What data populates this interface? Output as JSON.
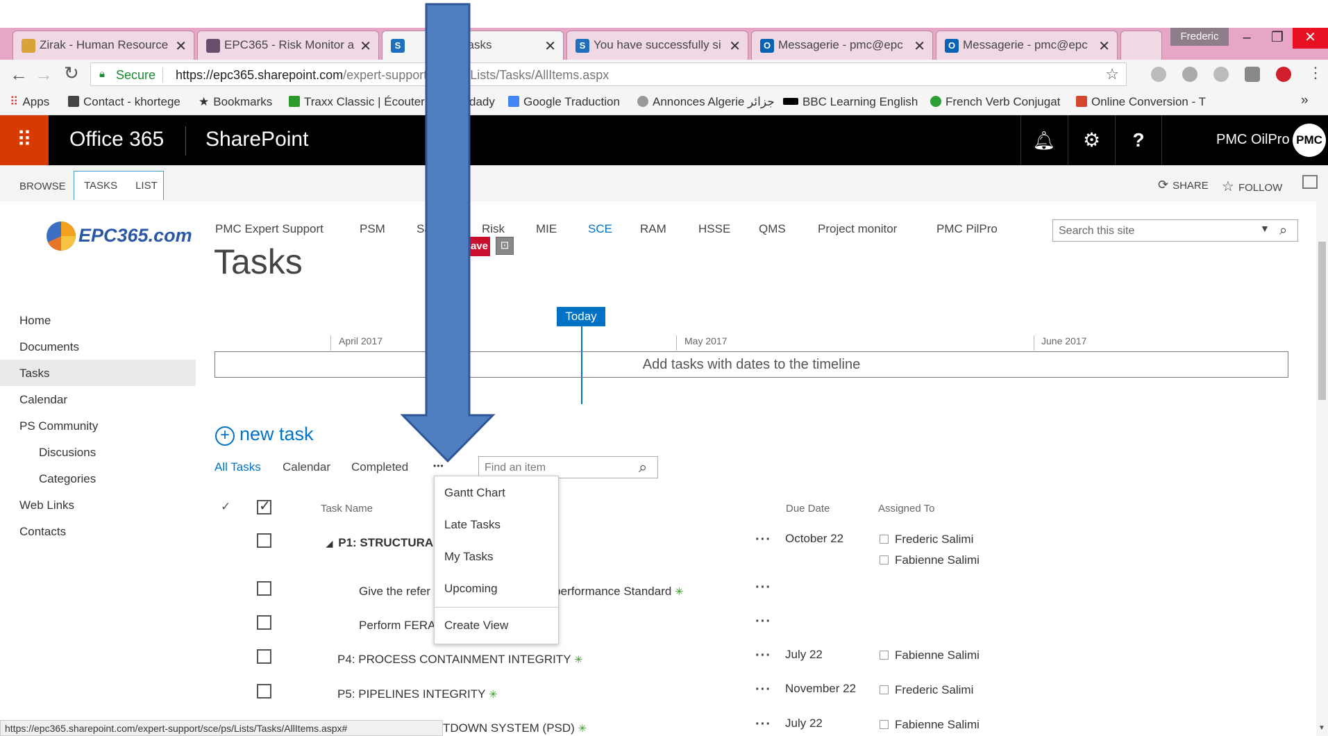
{
  "browser": {
    "tabs": [
      {
        "title": "Zirak - Human Resource",
        "icon_color": "#d9a33a"
      },
      {
        "title": "EPC365 - Risk Monitor a",
        "icon_color": "#6b4d6e"
      },
      {
        "title": "Tasks",
        "icon_color": "#1e6fbd"
      },
      {
        "title": "You have successfully si",
        "icon_color": "#1e6fbd"
      },
      {
        "title": "Messagerie - pmc@epc",
        "icon_color": "#0a62b5"
      },
      {
        "title": "Messagerie - pmc@epc",
        "icon_color": "#0a62b5"
      }
    ],
    "profile_name": "Frederic",
    "secure_label": "Secure",
    "url_host": "https://epc365.sharepoint.com",
    "url_path": "/expert-support/sce/ps/Lists/Tasks/AllItems.aspx",
    "bookmarks": [
      {
        "label": "Apps",
        "icon": "apps-grid-icon",
        "color": "#e53935"
      },
      {
        "label": "Contact - khortege",
        "icon": "bookmark-icon",
        "color": "#444"
      },
      {
        "label": "Bookmarks",
        "icon": "star-icon",
        "color": "#333"
      },
      {
        "label": "Traxx Classic | Écouter",
        "icon": "traxx-icon",
        "color": "#2a9a2a"
      },
      {
        "label": "dady",
        "icon": "page-icon",
        "color": "#888"
      },
      {
        "label": "Google Traduction",
        "icon": "google-translate-icon",
        "color": "#4285f4"
      },
      {
        "label": "Annonces Algerie جزائر",
        "icon": "annonces-icon",
        "color": "#999"
      },
      {
        "label": "BBC Learning English",
        "icon": "bbc-icon",
        "color": "#000"
      },
      {
        "label": "French Verb Conjugat",
        "icon": "conjugation-icon",
        "color": "#2e9e37"
      },
      {
        "label": "Online Conversion - T",
        "icon": "conversion-icon",
        "color": "#d4462d"
      }
    ],
    "more_bookmarks": "»",
    "status_url": "https://epc365.sharepoint.com/expert-support/sce/ps/Lists/Tasks/AllItems.aspx#"
  },
  "suite": {
    "office": "Office 365",
    "app": "SharePoint",
    "user": "PMC OilPro",
    "avatar": "PMC",
    "accent": "#d83b01"
  },
  "ribbon": {
    "tabs": [
      "BROWSE",
      "TASKS",
      "LIST"
    ],
    "share": "SHARE",
    "follow": "FOLLOW"
  },
  "site": {
    "logo_text": "EPC365.com",
    "topnav": [
      "PMC Expert Support",
      "PSM",
      "Sa",
      "Risk",
      "MIE",
      "SCE",
      "RAM",
      "HSSE",
      "QMS",
      "Project monitor",
      "PMC PilPro"
    ],
    "active_nav": "SCE",
    "search_placeholder": "Search this site",
    "page_title": "Tasks",
    "save_badge": "ave"
  },
  "quicklaunch": [
    {
      "label": "Home",
      "sub": false
    },
    {
      "label": "Documents",
      "sub": false
    },
    {
      "label": "Tasks",
      "sub": false
    },
    {
      "label": "Calendar",
      "sub": false
    },
    {
      "label": "PS Community",
      "sub": false
    },
    {
      "label": "Discusions",
      "sub": true
    },
    {
      "label": "Categories",
      "sub": true
    },
    {
      "label": "Web Links",
      "sub": false
    },
    {
      "label": "Contacts",
      "sub": false
    }
  ],
  "timeline": {
    "today": "Today",
    "months": [
      "April 2017",
      "May 2017",
      "June 2017"
    ],
    "placeholder": "Add tasks with dates to the timeline"
  },
  "list": {
    "new_task": "new task",
    "views": [
      "All Tasks",
      "Calendar",
      "Completed"
    ],
    "more": "•••",
    "find_placeholder": "Find an item",
    "columns": {
      "task": "Task Name",
      "due": "Due Date",
      "assigned": "Assigned To"
    },
    "rows": [
      {
        "name": "P1: STRUCTURA",
        "due": "October 22",
        "assigned": [
          "Frederic Salimi",
          "Fabienne Salimi"
        ],
        "bold": true,
        "indent": 1
      },
      {
        "name": "Give the refer",
        "name_tail": "s in performance Standard",
        "due": "",
        "assigned": [],
        "bold": false,
        "indent": 2
      },
      {
        "name": "Perform FERA",
        "due": "",
        "assigned": [],
        "bold": false,
        "indent": 2
      },
      {
        "name": "P4: PROCESS CONTAINMENT INTEGRITY",
        "due": "July 22",
        "assigned": [
          "Fabienne Salimi"
        ],
        "bold": false,
        "indent": 1
      },
      {
        "name": "P5: PIPELINES INTEGRITY",
        "due": "November 22",
        "assigned": [
          "Frederic Salimi"
        ],
        "bold": false,
        "indent": 1
      },
      {
        "name": "TDOWN SYSTEM (PSD)",
        "due": "July 22",
        "assigned": [
          "Fabienne Salimi"
        ],
        "bold": false,
        "indent": 1
      }
    ]
  },
  "dropdown": {
    "items": [
      "Gantt Chart",
      "Late Tasks",
      "My Tasks",
      "Upcoming"
    ],
    "create": "Create View"
  },
  "annotation": {
    "color": "#4f7fc0",
    "stroke": "#2f5597",
    "direction": "down"
  }
}
